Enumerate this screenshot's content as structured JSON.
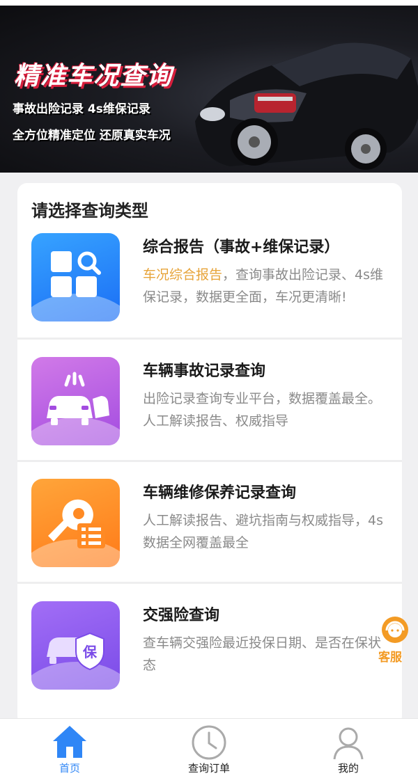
{
  "banner": {
    "title": "精准车况查询",
    "line1": "事故出险记录 4s维保记录",
    "line2": "全方位精准定位 还原真实车况"
  },
  "section": {
    "title": "请选择查询类型"
  },
  "items": [
    {
      "title": "综合报告（事故+维保记录）",
      "highlight": "车况综合报告",
      "desc": "，查询事故出险记录、4s维保记录，数据更全面，车况更清晰!",
      "icon": "report-search-icon",
      "color": "#1b6ef5"
    },
    {
      "title": "车辆事故记录查询",
      "desc": "出险记录查询专业平台，数据覆盖最全。人工解读报告、权威指导",
      "icon": "car-accident-icon",
      "color": "#a34ce0"
    },
    {
      "title": "车辆维修保养记录查询",
      "desc": "人工解读报告、避坑指南与权威指导，4s数据全网覆盖最全",
      "icon": "wrench-list-icon",
      "color": "#ff7a18"
    },
    {
      "title": "交强险查询",
      "desc": "查车辆交强险最近投保日期、是否在保状态",
      "icon": "car-insurance-icon",
      "icon_text": "保",
      "color": "#7a4be8"
    }
  ],
  "customer_service": {
    "label": "客服",
    "icon": "headset-agent-icon",
    "color": "#f39b25"
  },
  "tabbar": {
    "home": "首页",
    "orders": "查询订单",
    "mine": "我的",
    "active_color": "#2f86f6"
  }
}
